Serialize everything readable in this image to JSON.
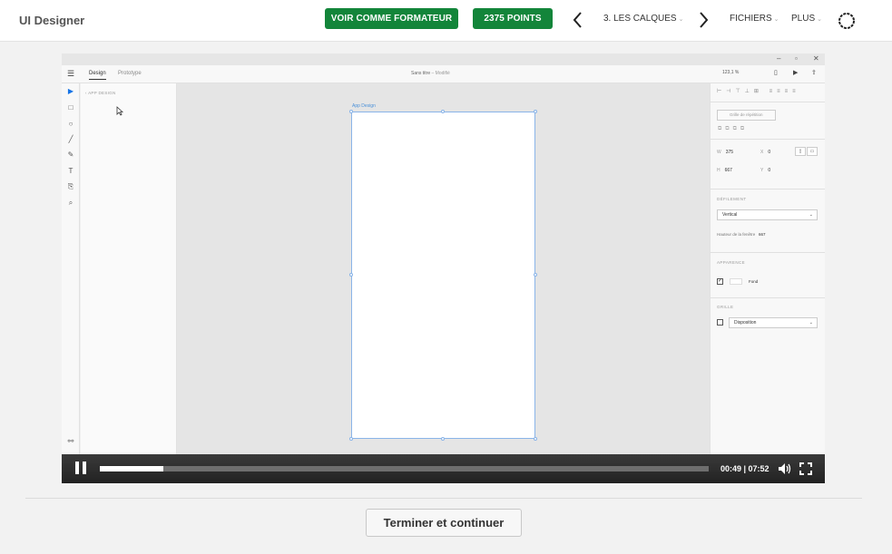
{
  "header": {
    "app_title": "UI Designer",
    "trainer_button": "VOIR COMME FORMATEUR",
    "points_button": "2375 POINTS",
    "prev_icon": "chevron-left-icon",
    "next_icon": "chevron-right-icon",
    "lesson_menu": "3. LES CALQUES",
    "files_menu": "FICHIERS",
    "more_menu": "PLUS",
    "settings_icon": "gear-icon",
    "accent_color": "#13853a"
  },
  "video": {
    "xd": {
      "tabs": [
        "Design",
        "Prototype"
      ],
      "doc_title": "Sans titre",
      "doc_status": "– Modifié",
      "zoom": "123,1 %",
      "layers_title": "APP DESIGN",
      "artboard_label": "App Design",
      "props": {
        "repeat_grid": "Grille de répétition",
        "w_label": "W",
        "w_value": "375",
        "x_label": "X",
        "x_value": "0",
        "h_label": "H",
        "h_value": "667",
        "y_label": "Y",
        "y_value": "0",
        "scroll_section": "DÉFILEMENT",
        "scroll_value": "Vertical",
        "viewport_label": "Hauteur de la fenêtre",
        "viewport_value": "667",
        "appearance_section": "APPARENCE",
        "fill_label": "Fond",
        "grid_section": "GRILLE",
        "grid_value": "Disposition"
      }
    },
    "controls": {
      "time": "00:49 | 07:52",
      "progress": 0.105,
      "pause_icon": "pause-icon",
      "volume_icon": "volume-icon",
      "fullscreen_icon": "fullscreen-icon"
    }
  },
  "footer": {
    "finish_button": "Terminer et continuer"
  }
}
